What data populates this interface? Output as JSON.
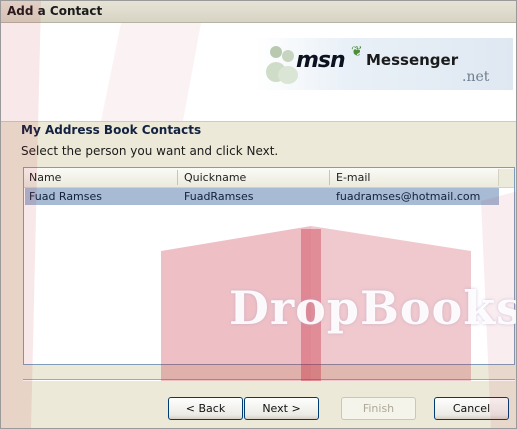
{
  "window": {
    "title": "Add a Contact"
  },
  "logo": {
    "msn": "msn",
    "messenger": "Messenger",
    "net": ".net"
  },
  "page": {
    "heading": "My Address Book Contacts",
    "instruction": "Select the person you want and click Next."
  },
  "list": {
    "columns": [
      "Name",
      "Quickname",
      "E-mail"
    ],
    "rows": [
      {
        "name": "Fuad Ramses",
        "quickname": "FuadRamses",
        "email": "fuadramses@hotmail.com",
        "selected": true
      }
    ]
  },
  "buttons": {
    "back": "< Back",
    "next": "Next >",
    "finish": "Finish",
    "cancel": "Cancel"
  },
  "watermark": "DropBooks",
  "colors": {
    "selection": "#a7bbd4",
    "watermark_red": "#c21c34",
    "dialog_bg": "#ece9d8"
  }
}
